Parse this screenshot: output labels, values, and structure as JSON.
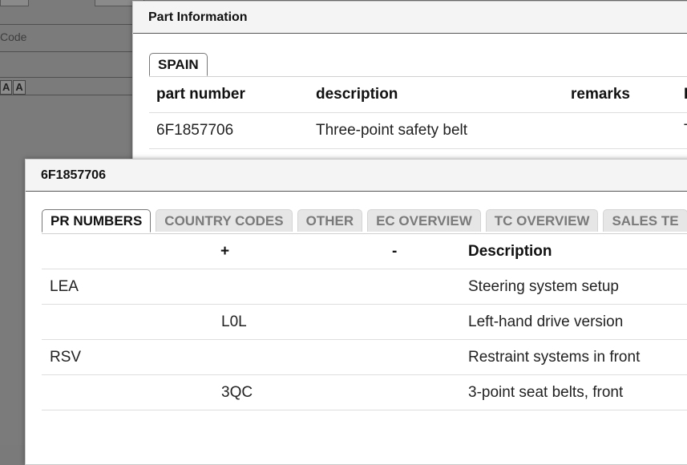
{
  "background": {
    "code_label": "Code",
    "font_icons": [
      "A",
      "A"
    ]
  },
  "part_dialog": {
    "title": "Part Information",
    "tabs": [
      {
        "label": "SPAIN",
        "active": true
      }
    ],
    "table": {
      "columns": [
        "part number",
        "description",
        "remarks",
        "I"
      ],
      "rows": [
        {
          "part_number": "6F1857706",
          "description": "Three-point safety belt",
          "remarks": "",
          "extra": "T"
        }
      ]
    }
  },
  "pr_dialog": {
    "title": "6F1857706",
    "tabs": [
      {
        "label": "PR NUMBERS",
        "active": true
      },
      {
        "label": "COUNTRY CODES",
        "active": false
      },
      {
        "label": "OTHER",
        "active": false
      },
      {
        "label": "EC OVERVIEW",
        "active": false
      },
      {
        "label": "TC OVERVIEW",
        "active": false
      },
      {
        "label": "SALES TE",
        "active": false
      }
    ],
    "table": {
      "columns": [
        "",
        "+",
        "-",
        "Description"
      ],
      "rows": [
        {
          "family": "LEA",
          "plus": "",
          "minus": "",
          "description": "Steering system setup"
        },
        {
          "family": "",
          "plus": "L0L",
          "minus": "",
          "description": "Left-hand drive version"
        },
        {
          "family": "RSV",
          "plus": "",
          "minus": "",
          "description": "Restraint systems in front"
        },
        {
          "family": "",
          "plus": "3QC",
          "minus": "",
          "description": "3-point seat belts, front"
        }
      ]
    }
  }
}
